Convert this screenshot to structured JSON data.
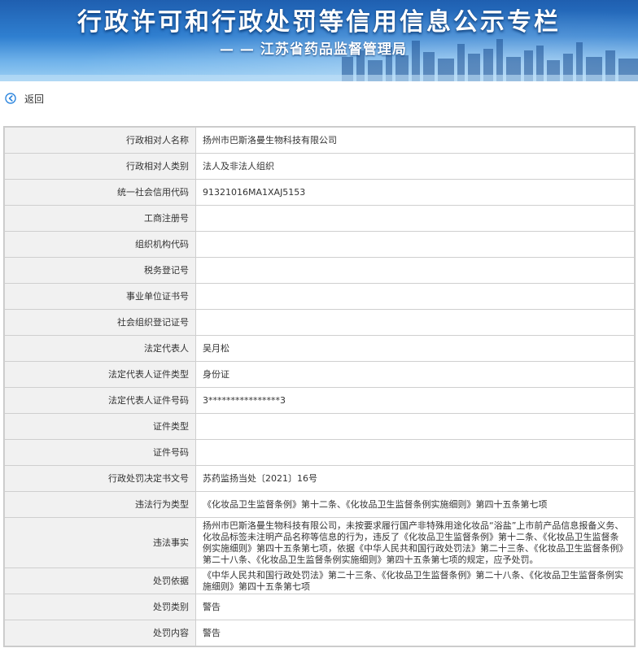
{
  "header": {
    "title": "行政许可和行政处罚等信用信息公示专栏",
    "subtitle": "— — 江苏省药品监督管理局"
  },
  "nav": {
    "back_label": "返回",
    "back_icon": "circle-arrow-left-icon"
  },
  "colors": {
    "banner_top": "#1f5fb0",
    "banner_bottom": "#9ccff3",
    "label_bg": "#f1f1f1",
    "border": "#cfcfcf"
  },
  "record": {
    "rows": [
      {
        "label": "行政相对人名称",
        "value": "扬州市巴斯洛曼生物科技有限公司"
      },
      {
        "label": "行政相对人类别",
        "value": "法人及非法人组织"
      },
      {
        "label": "统一社会信用代码",
        "value": "91321016MA1XAJ5153"
      },
      {
        "label": "工商注册号",
        "value": ""
      },
      {
        "label": "组织机构代码",
        "value": ""
      },
      {
        "label": "税务登记号",
        "value": ""
      },
      {
        "label": "事业单位证书号",
        "value": ""
      },
      {
        "label": "社会组织登记证号",
        "value": ""
      },
      {
        "label": "法定代表人",
        "value": "吴月松"
      },
      {
        "label": "法定代表人证件类型",
        "value": "身份证"
      },
      {
        "label": "法定代表人证件号码",
        "value": "3****************3"
      },
      {
        "label": "证件类型",
        "value": ""
      },
      {
        "label": "证件号码",
        "value": ""
      },
      {
        "label": "行政处罚决定书文号",
        "value": "苏药监扬当处〔2021〕16号"
      },
      {
        "label": "违法行为类型",
        "value": "《化妆品卫生监督条例》第十二条、《化妆品卫生监督条例实施细则》第四十五条第七项"
      },
      {
        "label": "违法事实",
        "value": "扬州市巴斯洛曼生物科技有限公司，未按要求履行国产非特殊用途化妆品“浴盐”上市前产品信息报备义务、化妆品标签未注明产品名称等信息的行为，违反了《化妆品卫生监督条例》第十二条、《化妆品卫生监督条例实施细则》第四十五条第七项，依据《中华人民共和国行政处罚法》第二十三条、《化妆品卫生监督条例》第二十八条、《化妆品卫生监督条例实施细则》第四十五条第七项的规定，应予处罚。"
      },
      {
        "label": "处罚依据",
        "value": "《中华人民共和国行政处罚法》第二十三条、《化妆品卫生监督条例》第二十八条、《化妆品卫生监督条例实施细则》第四十五条第七项"
      },
      {
        "label": "处罚类别",
        "value": "警告"
      },
      {
        "label": "处罚内容",
        "value": "警告"
      }
    ]
  }
}
